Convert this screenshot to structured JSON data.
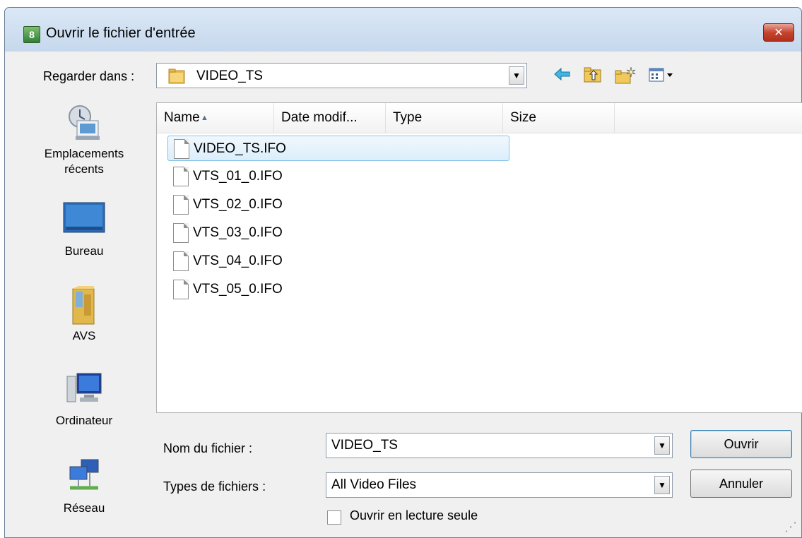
{
  "window": {
    "title": "Ouvrir le fichier d'entrée",
    "app_icon": "8",
    "close_symbol": "✕"
  },
  "toolbar": {
    "look_in_label": "Regarder dans :",
    "look_in_value": "VIDEO_TS",
    "icons": [
      "back-arrow-icon",
      "up-folder-icon",
      "new-folder-icon",
      "view-menu-icon"
    ]
  },
  "places": [
    {
      "label": "Emplacements récents",
      "icon": "recent-places-icon"
    },
    {
      "label": "Bureau",
      "icon": "desktop-icon"
    },
    {
      "label": "AVS",
      "icon": "avs-folder-icon"
    },
    {
      "label": "Ordinateur",
      "icon": "computer-icon"
    },
    {
      "label": "Réseau",
      "icon": "network-icon"
    }
  ],
  "columns": [
    "Name",
    "Date modif...",
    "Type",
    "Size"
  ],
  "files": [
    {
      "name": "VIDEO_TS.IFO",
      "selected": true
    },
    {
      "name": "VTS_01_0.IFO",
      "selected": false
    },
    {
      "name": "VTS_02_0.IFO",
      "selected": false
    },
    {
      "name": "VTS_03_0.IFO",
      "selected": false
    },
    {
      "name": "VTS_04_0.IFO",
      "selected": false
    },
    {
      "name": "VTS_05_0.IFO",
      "selected": false
    }
  ],
  "form": {
    "filename_label": "Nom du fichier :",
    "filename_value": "VIDEO_TS",
    "filetype_label": "Types de fichiers :",
    "filetype_value": "All Video Files",
    "readonly_label": "Ouvrir en lecture seule",
    "readonly_checked": false
  },
  "buttons": {
    "open": "Ouvrir",
    "cancel": "Annuler"
  },
  "colors": {
    "title_gradient_top": "#dbe8f6",
    "selection_border": "#84c0ea",
    "close_button": "#c6452f"
  }
}
